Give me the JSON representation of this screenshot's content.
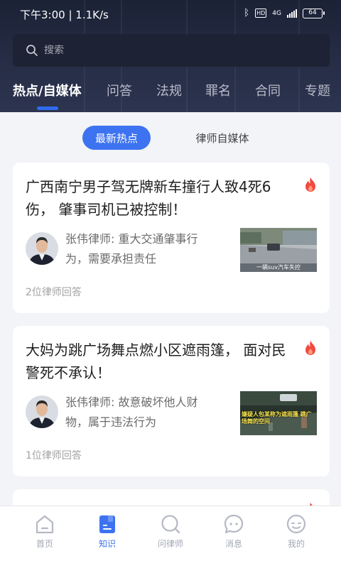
{
  "status_bar": {
    "time": "下午3:00 | 1.1K/s",
    "bluetooth_icon": "bluetooth-icon",
    "hd": "HD",
    "net": "4G",
    "battery": "64"
  },
  "search": {
    "placeholder": "搜索",
    "icon": "search-icon"
  },
  "category_tabs": [
    {
      "label": "热点/自媒体",
      "active": true
    },
    {
      "label": "问答"
    },
    {
      "label": "法规"
    },
    {
      "label": "罪名"
    },
    {
      "label": "合同"
    },
    {
      "label": "专题"
    }
  ],
  "segment": {
    "active": "最新热点",
    "inactive": "律师自媒体"
  },
  "cards": [
    {
      "title": "广西南宁男子驾无牌新车撞行人致4死6伤， 肇事司机已被控制！",
      "answer": "张伟律师: 重大交通肇事行为，需要承担责任",
      "count": "2位律师回答",
      "thumb_caption": "一辆suv汽车失控"
    },
    {
      "title": "大妈为跳广场舞点燃小区遮雨篷， 面对民警死不承认！",
      "answer": "张伟律师: 故意破坏他人财物，属于违法行为",
      "count": "1位律师回答",
      "thumb_caption": "嫌疑人包某称为遮雨篷 跳广场舞的空间"
    }
  ],
  "bottom_nav": [
    {
      "label": "首页",
      "icon": "home-icon"
    },
    {
      "label": "知识",
      "icon": "knowledge-icon",
      "active": true
    },
    {
      "label": "问律师",
      "icon": "ask-lawyer-icon"
    },
    {
      "label": "消息",
      "icon": "message-icon"
    },
    {
      "label": "我的",
      "icon": "profile-icon"
    }
  ],
  "colors": {
    "accent": "#3d73f1",
    "header": "#262d45",
    "fire": "#f04a3f"
  }
}
